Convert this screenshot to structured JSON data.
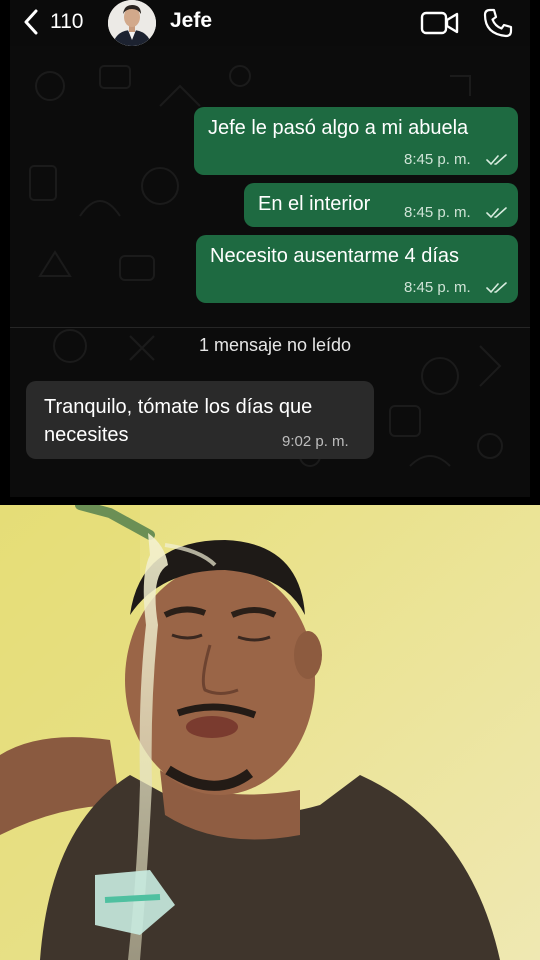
{
  "header": {
    "back_count": "110",
    "contact_name": "Jefe",
    "icons": {
      "back": "chevron-left-icon",
      "video": "video-call-icon",
      "phone": "phone-call-icon"
    }
  },
  "messages_out": [
    {
      "text": "Jefe le pasó algo a mi abuela",
      "time": "8:45 p. m.",
      "status": "read"
    },
    {
      "text": "En el interior",
      "time": "8:45 p. m.",
      "status": "read"
    },
    {
      "text": "Necesito ausentarme  4 días",
      "time": "8:45 p. m.",
      "status": "read"
    }
  ],
  "unread_divider": "1 mensaje no leído",
  "message_in": {
    "text": "Tranquilo, tómate los días que necesites",
    "time": "9:02 p. m."
  },
  "colors": {
    "outgoing_bubble": "#1e6a41",
    "incoming_bubble": "#2a2a2a",
    "chat_background": "#0c0c0c",
    "photo_wall": "#e9e28a"
  }
}
